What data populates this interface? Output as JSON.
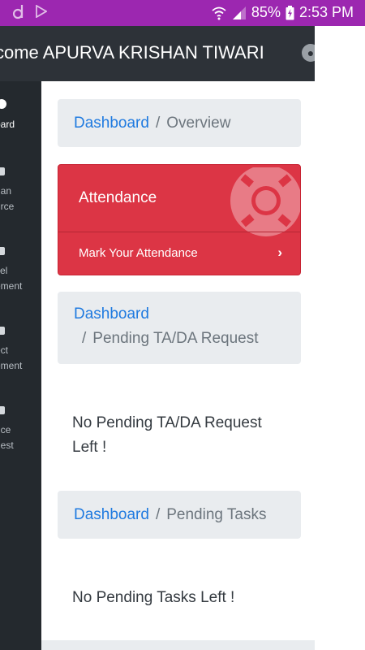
{
  "status_bar": {
    "battery": "85%",
    "time": "2:53 PM",
    "background": "#9c27b0"
  },
  "header": {
    "title": "come APURVA KRISHAN TIWARI"
  },
  "sidebar": {
    "items": [
      {
        "line1": "oard",
        "line2": ""
      },
      {
        "line1": "han",
        "line2": "urce"
      },
      {
        "line1": "vel",
        "line2": "ement"
      },
      {
        "line1": "ect",
        "line2": "ement"
      },
      {
        "line1": "nce",
        "line2": "uest"
      }
    ]
  },
  "main": {
    "crumb1": {
      "link": "Dashboard",
      "separator": "/",
      "current": "Overview"
    },
    "attendance_card": {
      "title": "Attendance",
      "footer_label": "Mark Your Attendance",
      "accent": "#dc3545"
    },
    "crumb2": {
      "link": "Dashboard",
      "separator": "/",
      "current": "Pending TA/DA Request"
    },
    "msg_tada": {
      "line1": "No Pending TA/DA Request",
      "line2": "Left !"
    },
    "crumb3": {
      "link": "Dashboard",
      "separator": "/",
      "current": "Pending Tasks"
    },
    "msg_tasks": "No Pending Tasks Left !"
  }
}
